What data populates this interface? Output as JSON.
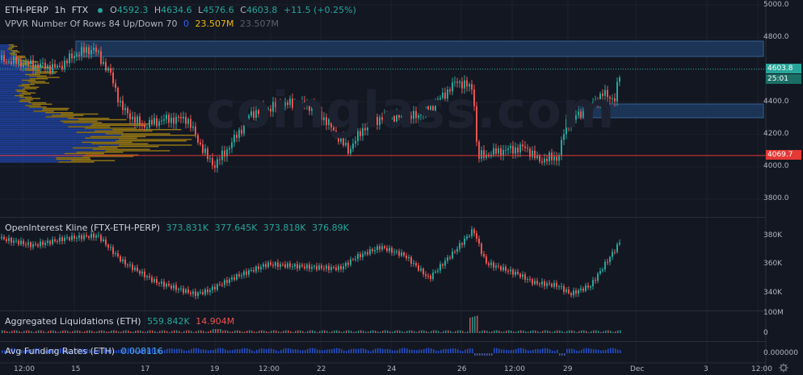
{
  "main_pane": {
    "symbol": "ETH-PERP",
    "interval": "1h",
    "exchange": "FTX",
    "ohlc": {
      "o_label": "O",
      "o": "4592.3",
      "h_label": "H",
      "h": "4634.6",
      "l_label": "L",
      "l": "4576.6",
      "c_label": "C",
      "c": "4603.8",
      "change": "+11.5 (+0.25%)"
    },
    "vpvr_label": "VPVR Number Of Rows 84 Up/Down 70",
    "vpvr_zero": "0",
    "vpvr_val1": "23.507M",
    "vpvr_val2": "23.507M",
    "watermark": "coinglass.com",
    "price_axis": [
      "5000.0",
      "4800.0",
      "4400.0",
      "4200.0",
      "4000.0",
      "3800.0"
    ],
    "last_price": "4603.8",
    "countdown": "25:01",
    "red_line_price": "4069.7"
  },
  "oi_pane": {
    "label": "OpenInterest Kline (FTX-ETH-PERP)",
    "o": "373.831K",
    "h": "377.645K",
    "l": "373.818K",
    "c": "376.89K",
    "axis": [
      "380K",
      "360K",
      "340K"
    ]
  },
  "liq_pane": {
    "label": "Aggregated Liquidations (ETH)",
    "long": "559.842K",
    "short": "14.904M",
    "axis": [
      "100M",
      "0"
    ]
  },
  "funding_pane": {
    "label": "Avg Funding Rates (ETH)",
    "value": "0.008116",
    "axis": [
      "0.000000"
    ]
  },
  "time_axis": [
    "12:00",
    "15",
    "17",
    "19",
    "12:00",
    "22",
    "24",
    "26",
    "12:00",
    "29",
    "Dec",
    "3",
    "12:00"
  ],
  "colors": {
    "background": "#131722",
    "up": "#26a69a",
    "down": "#ef5350",
    "vpvr_up": "#2962ff",
    "vpvr_down": "#f0b90b",
    "zone": "#1e3a5f",
    "zone_border": "#3b6fa8"
  },
  "icons": [
    "settings-gear-icon"
  ]
}
